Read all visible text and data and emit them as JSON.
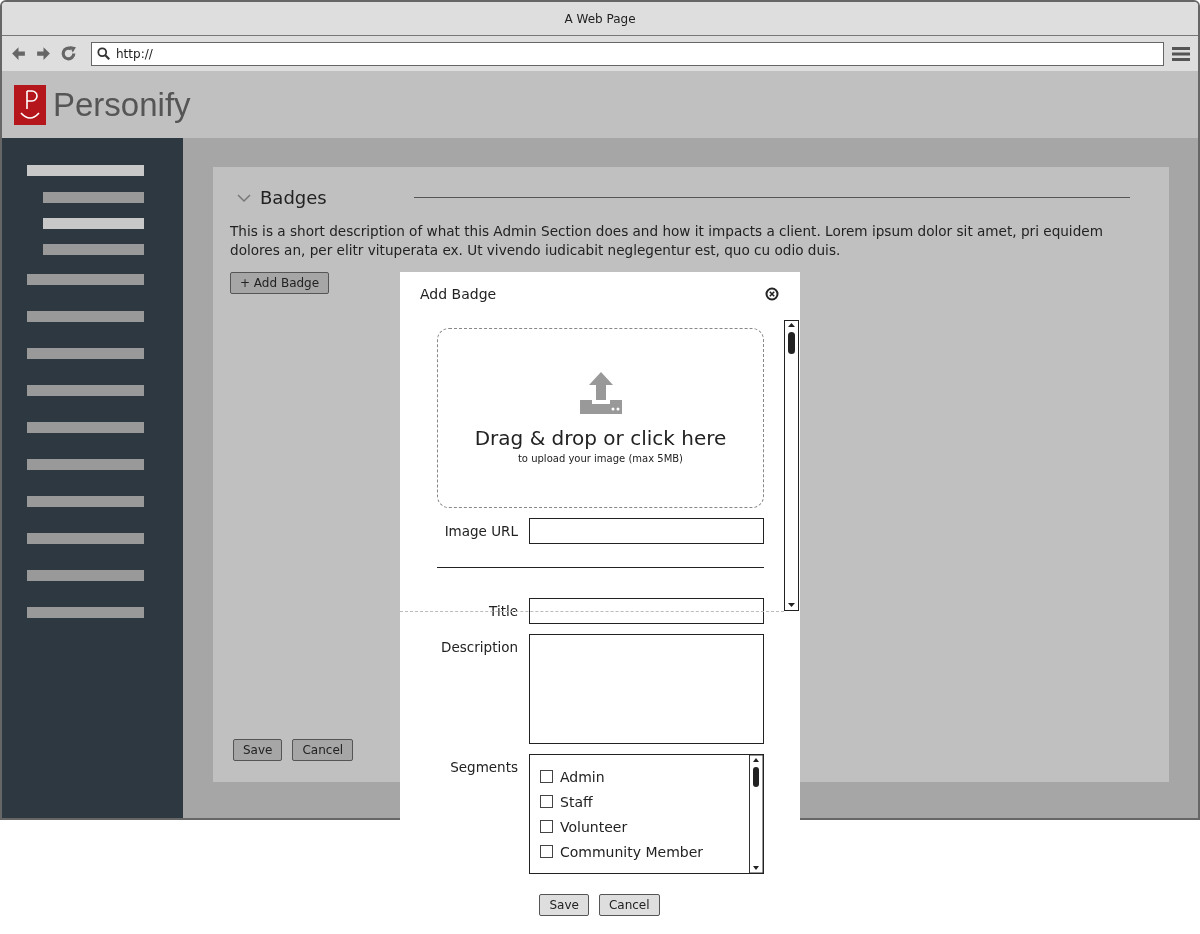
{
  "window": {
    "title": "A Web Page"
  },
  "browser": {
    "address": "http://"
  },
  "header": {
    "logo_text": "Personify"
  },
  "sidebar": {
    "items": [
      {
        "selected": true,
        "children": [
          {
            "selected": false
          },
          {
            "selected": true
          },
          {
            "selected": false
          }
        ]
      },
      {
        "selected": false
      },
      {
        "selected": false
      },
      {
        "selected": false
      },
      {
        "selected": false
      },
      {
        "selected": false
      },
      {
        "selected": false
      },
      {
        "selected": false
      },
      {
        "selected": false
      },
      {
        "selected": false
      },
      {
        "selected": false
      }
    ]
  },
  "section": {
    "title": "Badges",
    "expanded": true,
    "description": "This is a short description of what this Admin Section does and how it impacts a client. Lorem ipsum dolor sit amet, pri equidem dolores an, per elitr vituperata ex. Ut vivendo iudicabit neglegentur est, quo cu odio duis.",
    "add_button": "+ Add Badge",
    "buttons": [
      "Save",
      "Cancel"
    ]
  },
  "dialog": {
    "title": "Add Badge",
    "dropzone": {
      "heading": "Drag & drop or click here",
      "hint": "to upload your image (max 5MB)"
    },
    "fields": [
      {
        "kind": "text",
        "label": "Image URL"
      },
      {
        "kind": "divider"
      },
      {
        "kind": "text",
        "label": "Title"
      },
      {
        "kind": "textarea",
        "label": "Description"
      },
      {
        "kind": "checklist",
        "label": "Segments",
        "options": [
          {
            "label": "Admin",
            "checked": false
          },
          {
            "label": "Staff",
            "checked": false
          },
          {
            "label": "Volunteer",
            "checked": false
          },
          {
            "label": "Community Member",
            "checked": false
          }
        ]
      }
    ],
    "buttons": [
      "Save",
      "Cancel"
    ]
  }
}
